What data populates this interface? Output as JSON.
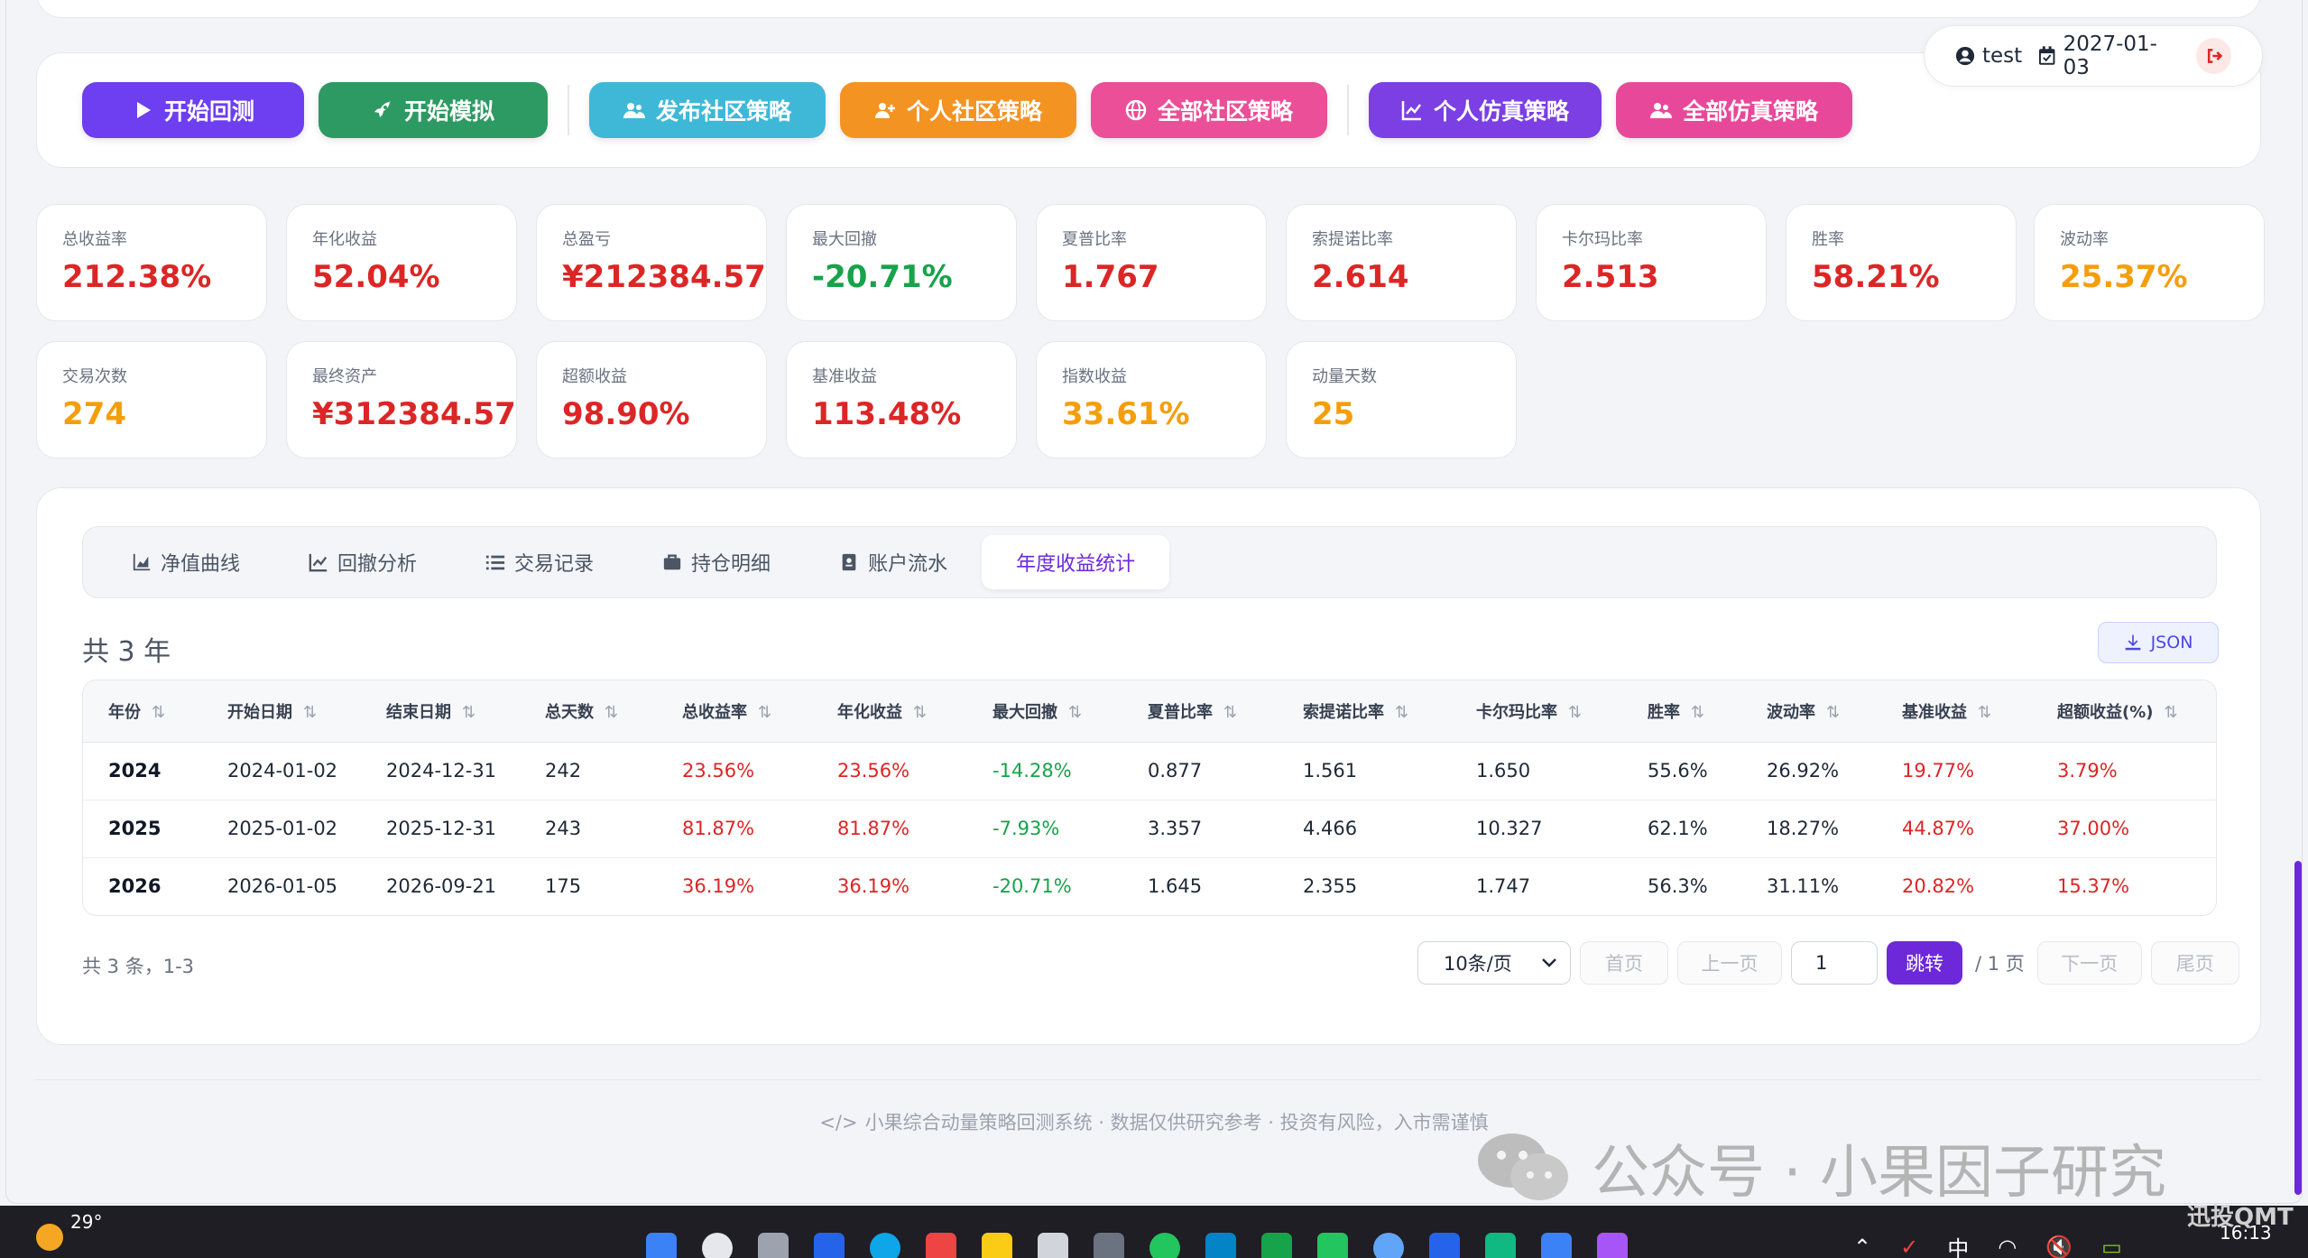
{
  "user": {
    "name": "test",
    "date": "2027-01-03"
  },
  "toolbar": {
    "buttons": [
      {
        "label": "开始回测",
        "color": "#6d3ff0"
      },
      {
        "label": "开始模拟",
        "color": "#2e9a63"
      },
      {
        "label": "发布社区策略",
        "color": "#3fb8d8"
      },
      {
        "label": "个人社区策略",
        "color": "#f39322"
      },
      {
        "label": "全部社区策略",
        "color": "#ea4f97"
      },
      {
        "label": "个人仿真策略",
        "color": "#7b3fe4"
      },
      {
        "label": "全部仿真策略",
        "color": "#e8489a"
      }
    ]
  },
  "metrics": [
    {
      "label": "总收益率",
      "value": "212.38%",
      "tone": "red"
    },
    {
      "label": "年化收益",
      "value": "52.04%",
      "tone": "red"
    },
    {
      "label": "总盈亏",
      "value": "¥212384.57",
      "tone": "red"
    },
    {
      "label": "最大回撤",
      "value": "-20.71%",
      "tone": "green"
    },
    {
      "label": "夏普比率",
      "value": "1.767",
      "tone": "red"
    },
    {
      "label": "索提诺比率",
      "value": "2.614",
      "tone": "red"
    },
    {
      "label": "卡尔玛比率",
      "value": "2.513",
      "tone": "red"
    },
    {
      "label": "胜率",
      "value": "58.21%",
      "tone": "red"
    },
    {
      "label": "波动率",
      "value": "25.37%",
      "tone": "orange"
    },
    {
      "label": "交易次数",
      "value": "274",
      "tone": "orange"
    },
    {
      "label": "最终资产",
      "value": "¥312384.57",
      "tone": "red"
    },
    {
      "label": "超额收益",
      "value": "98.90%",
      "tone": "red"
    },
    {
      "label": "基准收益",
      "value": "113.48%",
      "tone": "red"
    },
    {
      "label": "指数收益",
      "value": "33.61%",
      "tone": "orange"
    },
    {
      "label": "动量天数",
      "value": "25",
      "tone": "orange"
    }
  ],
  "tabs": [
    {
      "label": "净值曲线",
      "icon": "area-chart-icon"
    },
    {
      "label": "回撤分析",
      "icon": "line-chart-icon"
    },
    {
      "label": "交易记录",
      "icon": "list-icon"
    },
    {
      "label": "持仓明细",
      "icon": "briefcase-icon"
    },
    {
      "label": "账户流水",
      "icon": "ledger-icon"
    },
    {
      "label": "年度收益统计",
      "icon": ""
    }
  ],
  "active_tab": "年度收益统计",
  "summary_title": "共 3 年",
  "json_button": "JSON",
  "table": {
    "columns": [
      "年份",
      "开始日期",
      "结束日期",
      "总天数",
      "总收益率",
      "年化收益",
      "最大回撤",
      "夏普比率",
      "索提诺比率",
      "卡尔玛比率",
      "胜率",
      "波动率",
      "基准收益",
      "超额收益(%)"
    ],
    "rows": [
      [
        "2024",
        "2024-01-02",
        "2024-12-31",
        "242",
        "23.56%",
        "23.56%",
        "-14.28%",
        "0.877",
        "1.561",
        "1.650",
        "55.6%",
        "26.92%",
        "19.77%",
        "3.79%"
      ],
      [
        "2025",
        "2025-01-02",
        "2025-12-31",
        "243",
        "81.87%",
        "81.87%",
        "-7.93%",
        "3.357",
        "4.466",
        "10.327",
        "62.1%",
        "18.27%",
        "44.87%",
        "37.00%"
      ],
      [
        "2026",
        "2026-01-05",
        "2026-09-21",
        "175",
        "36.19%",
        "36.19%",
        "-20.71%",
        "1.645",
        "2.355",
        "1.747",
        "56.3%",
        "31.11%",
        "20.82%",
        "15.37%"
      ]
    ]
  },
  "pagination": {
    "info": "共 3 条，1-3",
    "page_size": "10条/页",
    "first": "首页",
    "prev": "上一页",
    "page_input": "1",
    "go": "跳转",
    "total_pages": "/ 1 页",
    "next": "下一页",
    "last": "尾页"
  },
  "footer": {
    "text": "小果综合动量策略回测系统 · 数据仅供研究参考 · 投资有风险，入市需谨慎"
  },
  "watermark": {
    "text": "公众号 · 小果因子研究"
  },
  "taskbar": {
    "temperature": "29°",
    "time": "16:13",
    "ime": "中",
    "brand": "迅投QMT"
  }
}
